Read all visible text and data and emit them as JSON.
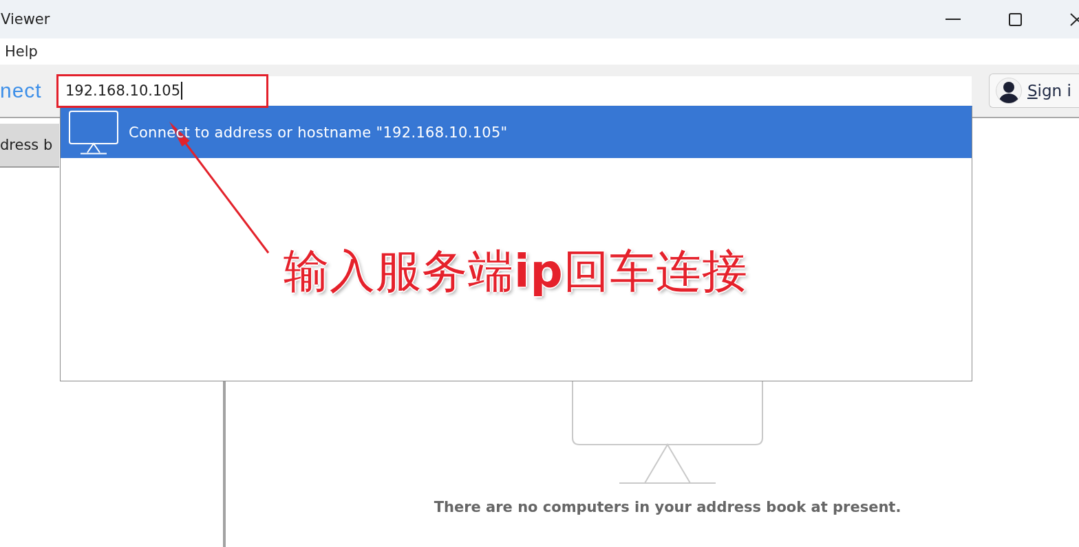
{
  "window": {
    "title": "Viewer"
  },
  "menu_bar": {
    "items": [
      {
        "label": "Help"
      }
    ]
  },
  "toolbar": {
    "logo": "nect",
    "search": {
      "value": "192.168.10.105",
      "focused": true
    },
    "sign_in": {
      "label": "Sign i"
    }
  },
  "tabs": [
    {
      "label": "dress b",
      "selected": true
    }
  ],
  "address_book": {
    "empty_message": "There are no computers in your address book at present."
  },
  "dropdown": {
    "items": [
      {
        "label": "Connect to address or hostname \"192.168.10.105\"",
        "selected": true
      }
    ]
  },
  "annotation": {
    "text": "输入服务端**ip**回车连接"
  }
}
